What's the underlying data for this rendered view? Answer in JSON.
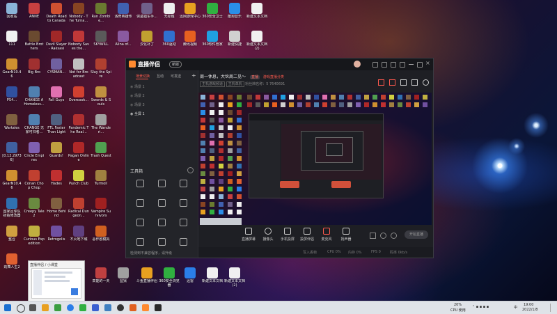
{
  "desktop": {
    "icons": [
      {
        "label": "回收站",
        "color": "#8ab4d8"
      },
      {
        "label": "ANNE",
        "color": "#c84040"
      },
      {
        "label": "Death Road to Canada",
        "color": "#d05030"
      },
      {
        "label": "Nobody - The Turna...",
        "color": "#884422"
      },
      {
        "label": "Run Zombie...",
        "color": "#6a7a30"
      },
      {
        "label": "洛奇英雄传",
        "color": "#4060b0"
      },
      {
        "label": "侠盗猎车手...",
        "color": "#70608a"
      },
      {
        "label": "无标题",
        "color": "#eeeeee"
      },
      {
        "label": "迅网游戏中心",
        "color": "#e8a020"
      },
      {
        "label": "360安全卫士",
        "color": "#30b040"
      },
      {
        "label": "酷狗音乐",
        "color": "#2a8ee8"
      },
      {
        "label": "新建文本文档",
        "color": "#f0f0f0"
      },
      {
        "label": "111",
        "color": "#f0f0f0"
      },
      {
        "label": "Battle Brothers",
        "color": "#6a4a30"
      },
      {
        "label": "Devil Slayer - Raksasi",
        "color": "#a02828"
      },
      {
        "label": "Nobody Saves the...",
        "color": "#c03838"
      },
      {
        "label": "SKYWILL",
        "color": "#5a5a5a"
      },
      {
        "label": "Alina of...",
        "color": "#8a5aa0"
      },
      {
        "label": "汉化补丁",
        "color": "#c0a030"
      },
      {
        "label": "360驱动",
        "color": "#3070d0"
      },
      {
        "label": "腾讯视频",
        "color": "#e86020"
      },
      {
        "label": "360软件管家",
        "color": "#20a0e0"
      },
      {
        "label": "新建快捷",
        "color": "#d0d0d0"
      },
      {
        "label": "新建文本文档(2)",
        "color": "#f0f0f0"
      },
      {
        "label": "GearN10.46",
        "color": "#d09030"
      },
      {
        "label": "Big Bro",
        "color": "#a03030"
      },
      {
        "label": "CYSMAN...",
        "color": "#7060a0"
      },
      {
        "label": "Not for Broadcast",
        "color": "#c0c0c0"
      },
      {
        "label": "Slay the Spire",
        "color": "#b04030"
      },
      {
        "label": "PS4...",
        "color": "#3050a0"
      },
      {
        "label": "CHANGE A Homeless...",
        "color": "#5080b0"
      },
      {
        "label": "Fall Guys",
        "color": "#e070b0"
      },
      {
        "label": "Overcook...",
        "color": "#d04030"
      },
      {
        "label": "Swords & Souls",
        "color": "#c09040"
      },
      {
        "label": "Wartales",
        "color": "#806040"
      },
      {
        "label": "CHANGE 无家可归者...",
        "color": "#5080b0"
      },
      {
        "label": "FTL Faster Than Light",
        "color": "#506080"
      },
      {
        "label": "Pandemic The Real...",
        "color": "#b03030"
      },
      {
        "label": "The Wanderi...",
        "color": "#a0a0a0"
      },
      {
        "label": "[0.12.29736]",
        "color": "#4060a0"
      },
      {
        "label": "Circle Empires",
        "color": "#8060b0"
      },
      {
        "label": "Guards!",
        "color": "#c0a040"
      },
      {
        "label": "Pagan Online",
        "color": "#b02828"
      },
      {
        "label": "Trash Quest",
        "color": "#50a050"
      },
      {
        "label": "GearN10.46",
        "color": "#d09030"
      },
      {
        "label": "Conan Chop Chop",
        "color": "#c04030"
      },
      {
        "label": "Hades",
        "color": "#c03030"
      },
      {
        "label": "Punch Club",
        "color": "#d0d040"
      },
      {
        "label": "Turmoil",
        "color": "#a08040"
      },
      {
        "label": "国家足球队 初始修改器",
        "color": "#3070b0"
      },
      {
        "label": "Creepy Tale 2",
        "color": "#6a8a40"
      },
      {
        "label": "Home Behind",
        "color": "#806040"
      },
      {
        "label": "Radical Dungeon...",
        "color": "#c04030"
      },
      {
        "label": "Vampire Survivors",
        "color": "#a02020"
      },
      {
        "label": "整合",
        "color": "#d0a040"
      },
      {
        "label": "Curious Expedition",
        "color": "#c0b040"
      },
      {
        "label": "Retrogolis",
        "color": "#7050a0"
      },
      {
        "label": "不灭地下城",
        "color": "#604080"
      },
      {
        "label": "恶作剧模拟",
        "color": "#d06020"
      },
      {
        "label": "劲舞人生2",
        "color": "#e06030"
      },
      {
        "label": "高能的一天",
        "color": "#c04040"
      },
      {
        "label": "监狱",
        "color": "#a0a0a0"
      },
      {
        "label": "斗鱼直播伴侣",
        "color": "#e8a020"
      },
      {
        "label": "360安全浏览器",
        "color": "#30b040"
      },
      {
        "label": "迅雷",
        "color": "#2a7ee8"
      },
      {
        "label": "新建文本文档",
        "color": "#f0f0f0"
      },
      {
        "label": "新建文本文档(2)",
        "color": "#f0f0f0"
      }
    ]
  },
  "live_app": {
    "title": "直播伴侣",
    "badge": "新版",
    "tabs": [
      "场景切换",
      "互动",
      "可发送"
    ],
    "scenes": [
      "场景 1",
      "场景 2",
      "场景 3",
      "全屏 1"
    ],
    "tools_title": "工具箱",
    "stream_title": "周一休息，大伙周二见～",
    "stream_tag": "直播",
    "stream_tag2": "游戏直播分类",
    "meta": [
      "主机游戏频道",
      "主机单机",
      "粉丝牌名称：5",
      "7640691"
    ],
    "bottom_buttons": [
      "直播屏幕",
      "摄像头",
      "手机投屏",
      "投屏伴侣",
      "麦克风",
      "扬声器"
    ],
    "start_button": "开始直播",
    "status": [
      "写入丢帧",
      "CPU 0%",
      "内存 0%",
      "FPS 0",
      "码率 0kb/s"
    ],
    "warning": "检测到不兼容程序，请升级"
  },
  "thumbnail": {
    "title": "直播伴侣 / 小课堂"
  },
  "taskbar": {
    "cpu": "20%",
    "cpu_label": "CPU 使用",
    "lang": "中",
    "time": "19:00",
    "date": "2022/1/8"
  },
  "colors": {
    "accent": "#ff5a4e",
    "window_bg": "#1e1f24",
    "taskbar": "#dfe3e8"
  }
}
